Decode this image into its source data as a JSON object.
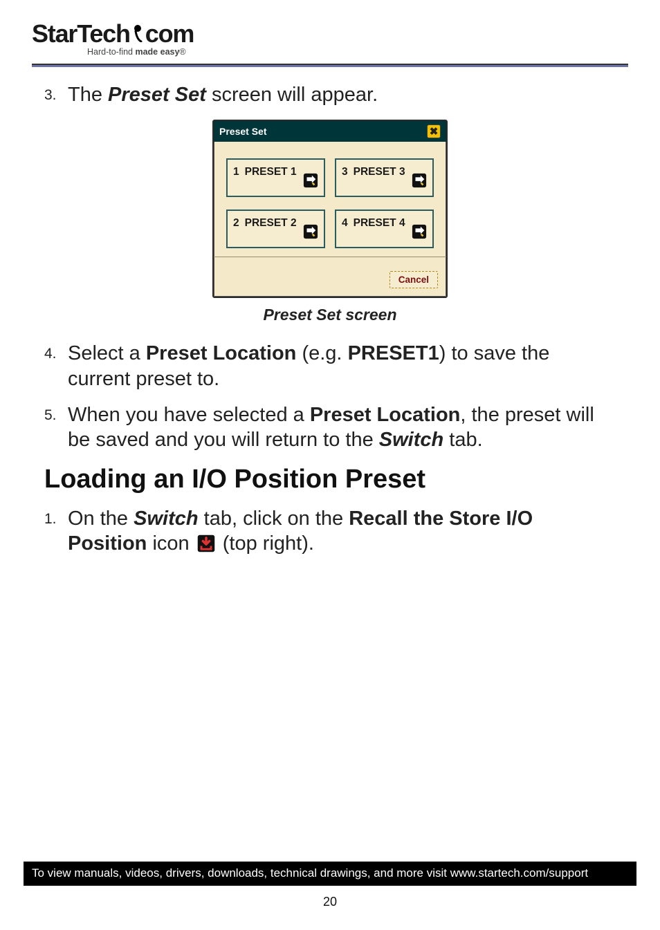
{
  "logo": {
    "brand_left": "StarTech",
    "brand_right": "com",
    "tagline_plain": "Hard-to-find ",
    "tagline_bold": "made easy",
    "tagline_mark": "®"
  },
  "steps_a": [
    {
      "num": "3.",
      "pre": "The ",
      "bi": "Preset Set",
      "post": " screen will appear."
    }
  ],
  "dialog": {
    "title": "Preset Set",
    "close_glyph": "✖",
    "presets": [
      {
        "n": "1",
        "label": "PRESET 1"
      },
      {
        "n": "3",
        "label": "PRESET 3"
      },
      {
        "n": "2",
        "label": "PRESET 2"
      },
      {
        "n": "4",
        "label": "PRESET 4"
      }
    ],
    "cancel": "Cancel"
  },
  "caption": "Preset Set screen",
  "steps_b": [
    {
      "num": "4.",
      "parts": [
        {
          "t": "Select a ",
          "cls": ""
        },
        {
          "t": "Preset Location",
          "cls": "b"
        },
        {
          "t": " (e.g. ",
          "cls": ""
        },
        {
          "t": "PRESET1",
          "cls": "b"
        },
        {
          "t": ") to save the current preset to.",
          "cls": ""
        }
      ]
    },
    {
      "num": "5.",
      "parts": [
        {
          "t": "When you have selected a ",
          "cls": ""
        },
        {
          "t": "Preset Location",
          "cls": "b"
        },
        {
          "t": ", the preset will be saved and you will return to the ",
          "cls": ""
        },
        {
          "t": "Switch",
          "cls": "bi"
        },
        {
          "t": " tab.",
          "cls": ""
        }
      ]
    }
  ],
  "section_heading": "Loading an I/O Position Preset",
  "steps_c": [
    {
      "num": "1.",
      "line1": [
        {
          "t": "On the ",
          "cls": ""
        },
        {
          "t": "Switch",
          "cls": "bi"
        },
        {
          "t": " tab, click on the ",
          "cls": ""
        },
        {
          "t": "Recall the Store I/O Position",
          "cls": "b"
        }
      ],
      "line2_pre": "icon ",
      "line2_post": " (top right)."
    }
  ],
  "footer": "To view manuals, videos, drivers, downloads, technical drawings, and more visit www.startech.com/support",
  "page_number": "20"
}
